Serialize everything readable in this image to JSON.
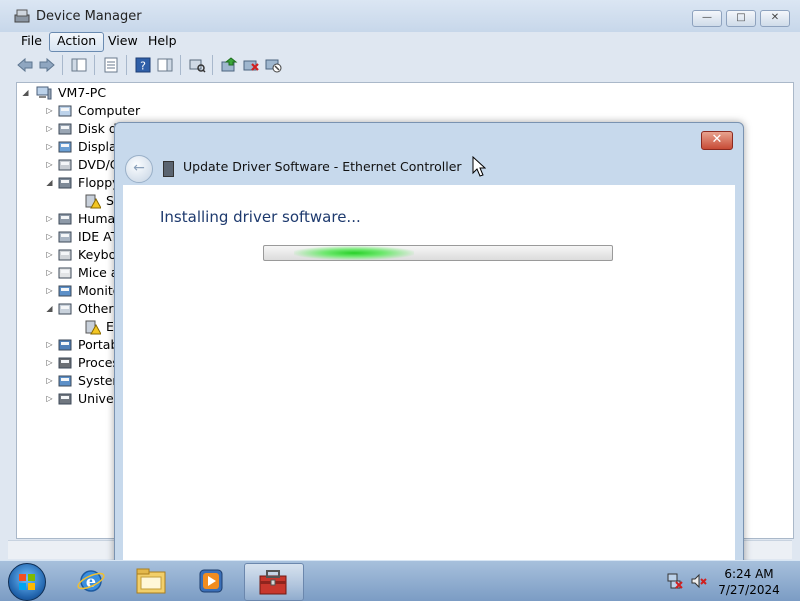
{
  "window": {
    "title": "Device Manager",
    "buttons": {
      "minimize": "—",
      "maximize": "□",
      "close": "✕"
    }
  },
  "menu": [
    "File",
    "Action",
    "View",
    "Help"
  ],
  "tree": {
    "root": "VM7-PC",
    "items": [
      {
        "label": "Computer",
        "expander": "▷",
        "icon": "computer-icon"
      },
      {
        "label": "Disk dr",
        "expander": "▷",
        "icon": "disk-drive-icon"
      },
      {
        "label": "Display",
        "expander": "▷",
        "icon": "display-adapter-icon"
      },
      {
        "label": "DVD/C",
        "expander": "▷",
        "icon": "dvd-drive-icon"
      },
      {
        "label": "Floppy",
        "expander": "◢",
        "icon": "floppy-controller-icon"
      },
      {
        "label": "Sta",
        "expander": "",
        "icon": "warning-device-icon",
        "child": true
      },
      {
        "label": "Human",
        "expander": "▷",
        "icon": "hid-icon"
      },
      {
        "label": "IDE ATA",
        "expander": "▷",
        "icon": "ide-controller-icon"
      },
      {
        "label": "Keyboa",
        "expander": "▷",
        "icon": "keyboard-icon"
      },
      {
        "label": "Mice ar",
        "expander": "▷",
        "icon": "mouse-icon"
      },
      {
        "label": "Monito",
        "expander": "▷",
        "icon": "monitor-icon"
      },
      {
        "label": "Other d",
        "expander": "◢",
        "icon": "other-devices-icon"
      },
      {
        "label": "Eth",
        "expander": "",
        "icon": "warning-device-icon",
        "child": true
      },
      {
        "label": "Portabl",
        "expander": "▷",
        "icon": "portable-device-icon"
      },
      {
        "label": "Process",
        "expander": "▷",
        "icon": "processor-icon"
      },
      {
        "label": "System",
        "expander": "▷",
        "icon": "system-device-icon"
      },
      {
        "label": "Univers",
        "expander": "▷",
        "icon": "usb-icon"
      }
    ]
  },
  "dialog": {
    "title": "Update Driver Software - Ethernet Controller",
    "heading": "Installing driver software...",
    "close_label": "✕",
    "back_glyph": "←",
    "progress": "indeterminate"
  },
  "taskbar": {
    "time": "6:24 AM",
    "date": "7/27/2024"
  },
  "colors": {
    "dialog_heading": "#1e3a6e",
    "progress_glow": "#28d028",
    "close_button": "#c74b36"
  }
}
